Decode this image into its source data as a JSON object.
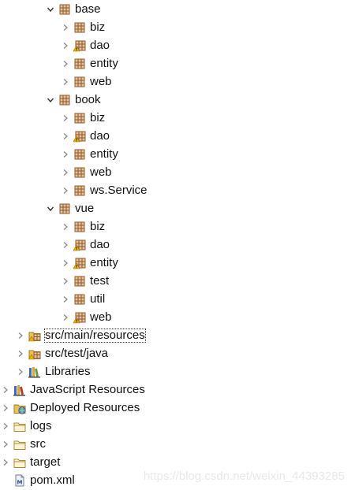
{
  "tree": [
    {
      "label": "base",
      "icon": "package-icon",
      "expanded": true
    },
    {
      "label": "biz",
      "icon": "package-icon",
      "expanded": false
    },
    {
      "label": "dao",
      "icon": "package-warning-icon",
      "expanded": false
    },
    {
      "label": "entity",
      "icon": "package-icon",
      "expanded": false
    },
    {
      "label": "web",
      "icon": "package-icon",
      "expanded": false
    },
    {
      "label": "book",
      "icon": "package-icon",
      "expanded": true
    },
    {
      "label": "biz",
      "icon": "package-icon",
      "expanded": false
    },
    {
      "label": "dao",
      "icon": "package-warning-icon",
      "expanded": false
    },
    {
      "label": "entity",
      "icon": "package-icon",
      "expanded": false
    },
    {
      "label": "web",
      "icon": "package-icon",
      "expanded": false
    },
    {
      "label": "ws.Service",
      "icon": "package-icon",
      "expanded": false
    },
    {
      "label": "vue",
      "icon": "package-icon",
      "expanded": true
    },
    {
      "label": "biz",
      "icon": "package-icon",
      "expanded": false
    },
    {
      "label": "dao",
      "icon": "package-warning-icon",
      "expanded": false
    },
    {
      "label": "entity",
      "icon": "package-warning-icon",
      "expanded": false
    },
    {
      "label": "test",
      "icon": "package-icon",
      "expanded": false
    },
    {
      "label": "util",
      "icon": "package-icon",
      "expanded": false
    },
    {
      "label": "web",
      "icon": "package-warning-icon",
      "expanded": false
    },
    {
      "label": "src/main/resources",
      "icon": "source-folder-icon",
      "expanded": false,
      "selected": true
    },
    {
      "label": "src/test/java",
      "icon": "source-folder-icon",
      "expanded": false
    },
    {
      "label": "Libraries",
      "icon": "libraries-icon",
      "expanded": false
    },
    {
      "label": "JavaScript Resources",
      "icon": "javascript-resources-icon",
      "expanded": false
    },
    {
      "label": "Deployed Resources",
      "icon": "deployed-resources-icon",
      "expanded": false
    },
    {
      "label": "logs",
      "icon": "folder-icon",
      "expanded": false
    },
    {
      "label": "src",
      "icon": "folder-icon",
      "expanded": false
    },
    {
      "label": "target",
      "icon": "folder-icon",
      "expanded": false
    },
    {
      "label": "pom.xml",
      "icon": "maven-file-icon",
      "leaf": true
    }
  ],
  "watermark": "https://blog.csdn.net/weixin_44393285",
  "colors": {
    "chevron": "#8a8a8a",
    "package_brown": "#8b5a2b",
    "package_fill": "#e8c39a",
    "warning": "#f2b400",
    "folder": "#e9c25a",
    "watermark": "#e8e8e8"
  }
}
